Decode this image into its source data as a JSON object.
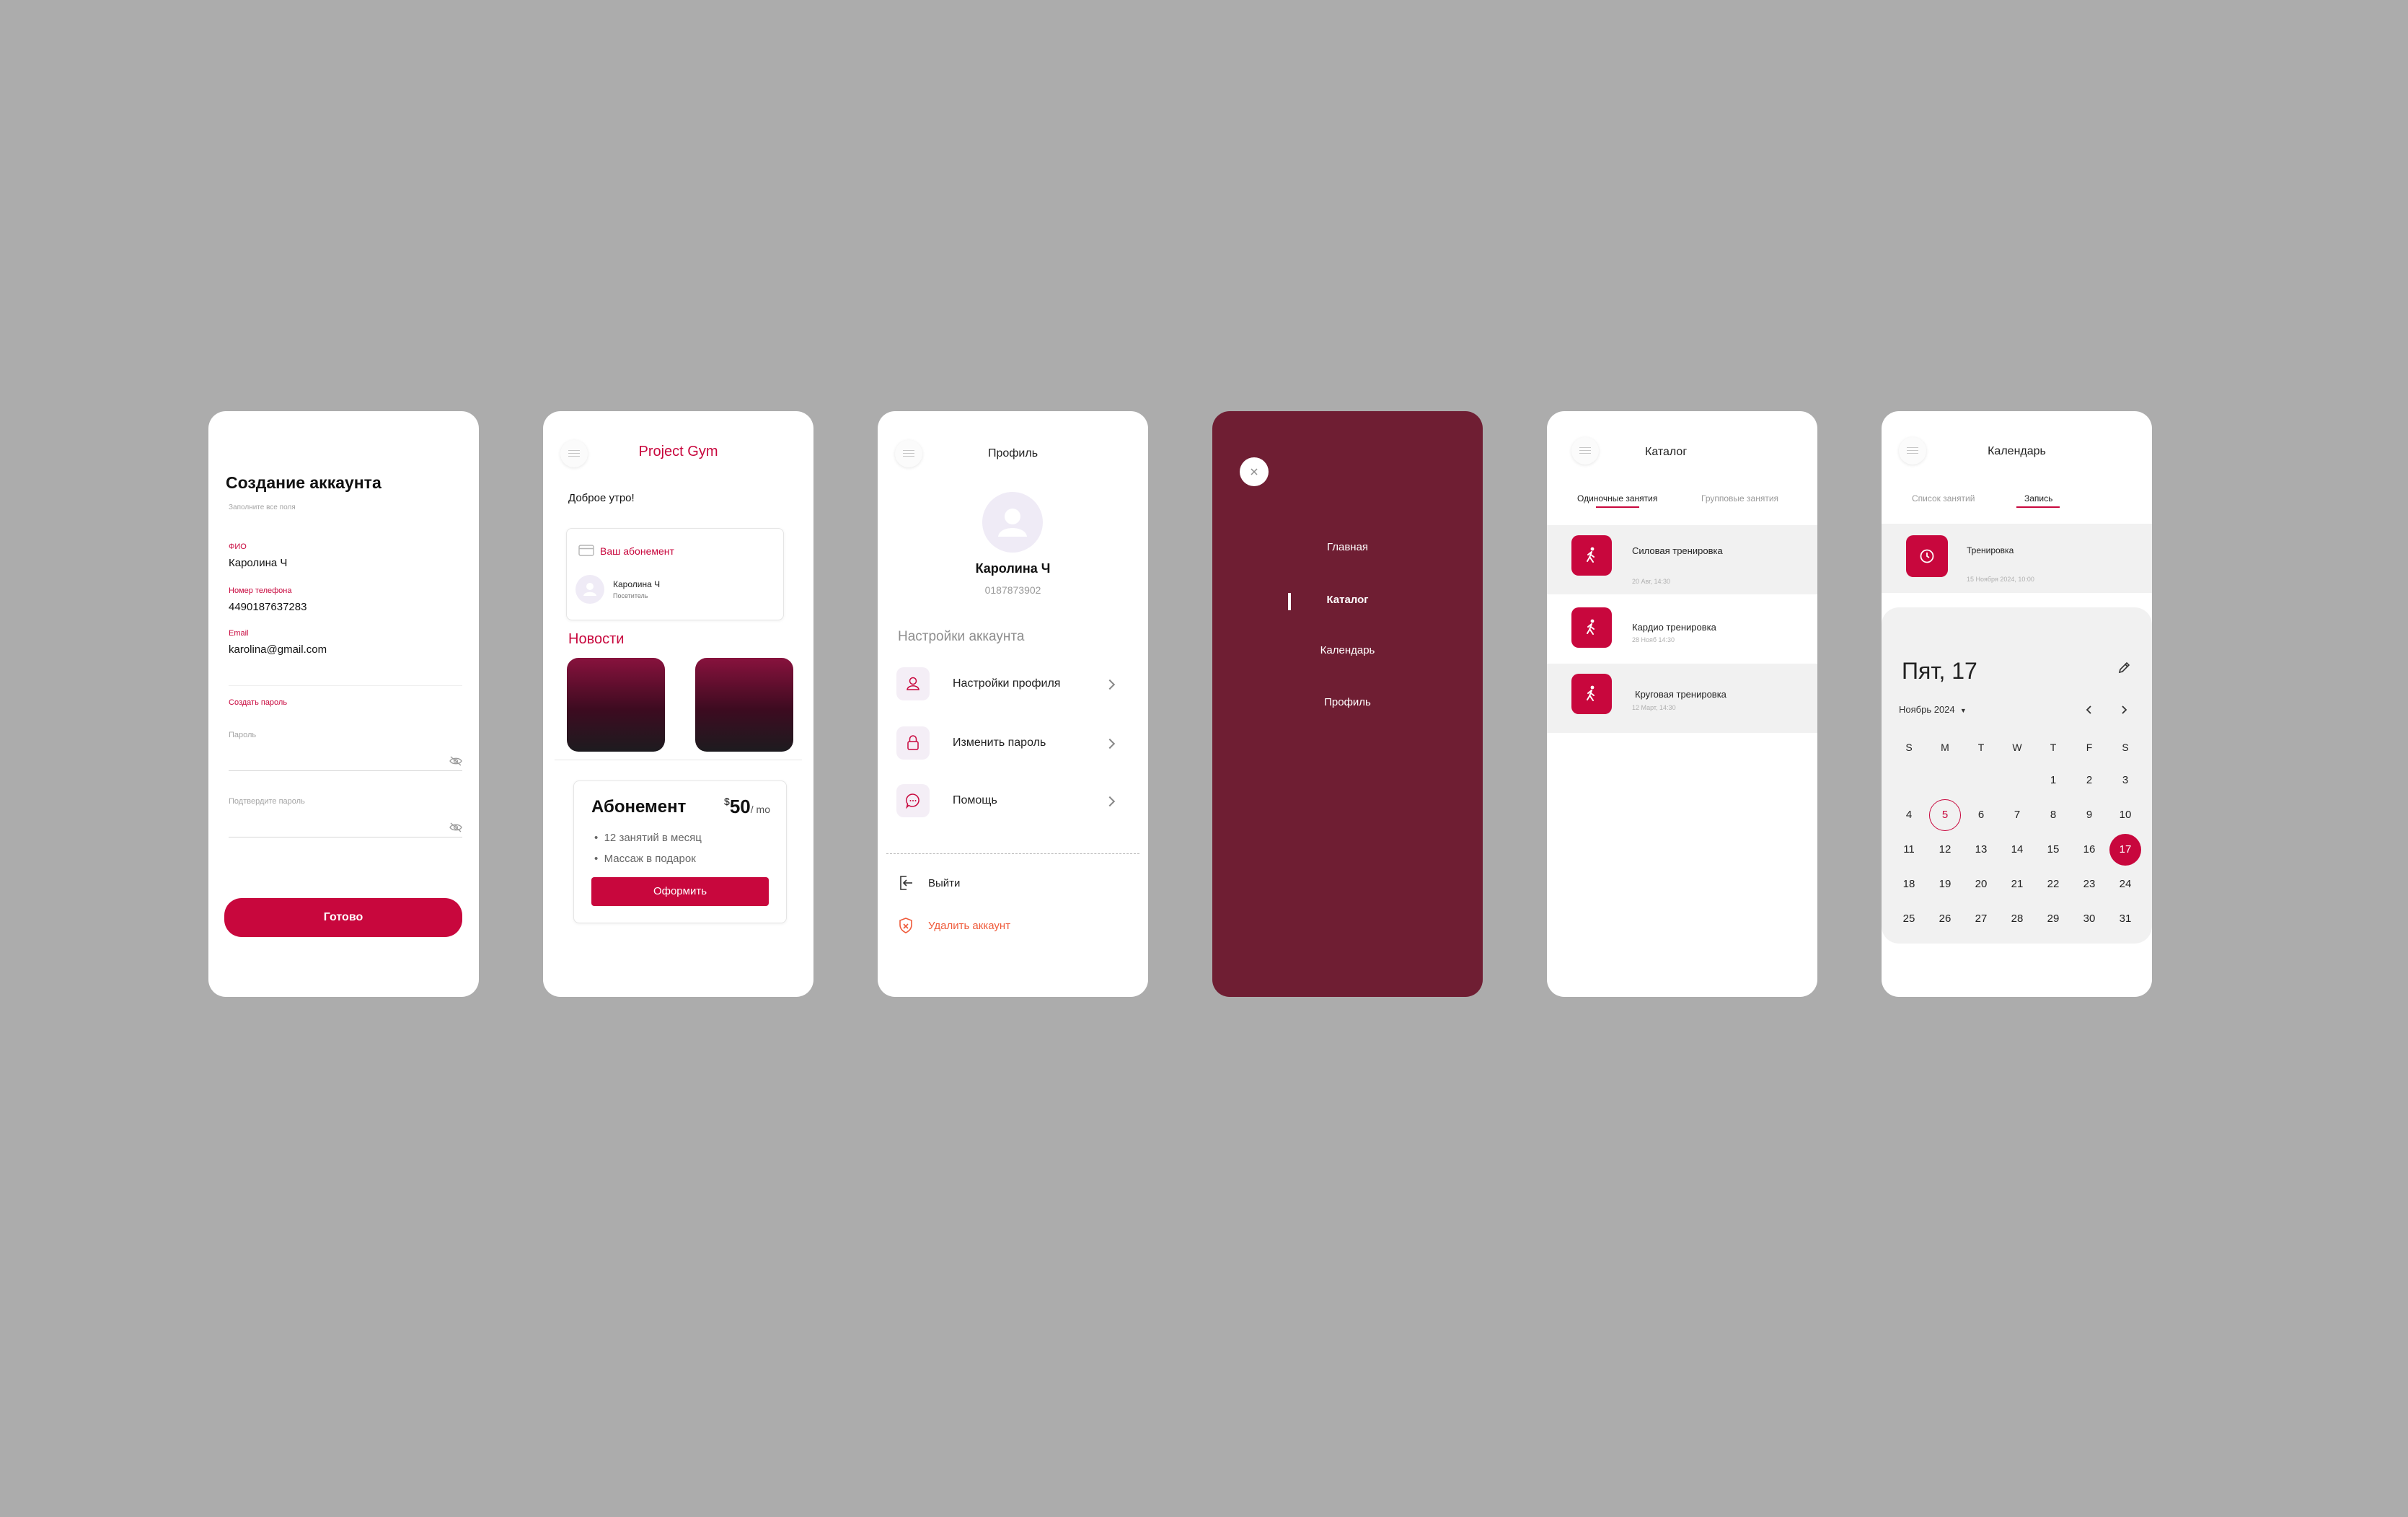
{
  "colors": {
    "background": "#acacac",
    "accent": "#c8073d",
    "drawer": "#6f1e33"
  },
  "signup": {
    "title": "Создание аккаунта",
    "subtitle": "Заполните все поля",
    "name_label": "ФИО",
    "name_value": "Каролина Ч",
    "phone_label": "Номер телефона",
    "phone_value": "4490187637283",
    "email_label": "Email",
    "email_value": "karolina@gmail.com",
    "password_section": "Создать пароль",
    "password_placeholder": "Пароль",
    "confirm_placeholder": "Подтвердите пароль",
    "submit": "Готово"
  },
  "home": {
    "title": "Project Gym",
    "greeting": "Доброе утро!",
    "subscription_link": "Ваш абонемент",
    "member_name": "Каролина Ч",
    "member_role": "Посетитель",
    "news_title": "Новости",
    "plan_title": "Абонемент",
    "plan_currency": "$",
    "plan_price": "50",
    "plan_period": "/ mo",
    "plan_features": [
      "12 занятий в месяц",
      "Массаж в подарок"
    ],
    "plan_button": "Оформить"
  },
  "profile": {
    "title": "Профиль",
    "name": "Каролина Ч",
    "phone": "0187873902",
    "settings_title": "Настройки аккаунта",
    "items": [
      {
        "label": "Настройки профиля",
        "icon": "user-icon"
      },
      {
        "label": "Изменить пароль",
        "icon": "lock-icon"
      },
      {
        "label": "Помощь",
        "icon": "chat-icon"
      }
    ],
    "logout": "Выйти",
    "delete": "Удалить аккаунт"
  },
  "drawer": {
    "items": [
      "Главная",
      "Каталог",
      "Календарь",
      "Профиль"
    ],
    "active": "Каталог"
  },
  "catalog": {
    "title": "Каталог",
    "tabs": [
      "Одиночные занятия",
      "Групповые занятия"
    ],
    "items": [
      {
        "title": "Силовая тренировка",
        "date": "20 Авг, 14:30"
      },
      {
        "title": "Кардио тренировка",
        "date": "28 Нояб 14:30"
      },
      {
        "title": "Круговая тренировка",
        "date": "12 Март, 14:30"
      }
    ]
  },
  "calendar": {
    "title": "Календарь",
    "tabs": [
      "Список занятий",
      "Запись"
    ],
    "booking_title": "Тренировка",
    "booking_date": "15 Ноября 2024, 10:00",
    "selected_label": "Пят, 17",
    "month_label": "Ноябрь 2024",
    "weekdays": [
      "S",
      "M",
      "T",
      "W",
      "T",
      "F",
      "S"
    ],
    "days": [
      "1",
      "2",
      "3",
      "4",
      "5",
      "6",
      "7",
      "8",
      "9",
      "10",
      "11",
      "12",
      "13",
      "14",
      "15",
      "16",
      "17",
      "18",
      "19",
      "20",
      "21",
      "22",
      "23",
      "24",
      "25",
      "26",
      "27",
      "28",
      "29",
      "30",
      "31"
    ],
    "today": "5",
    "selected": "17"
  }
}
